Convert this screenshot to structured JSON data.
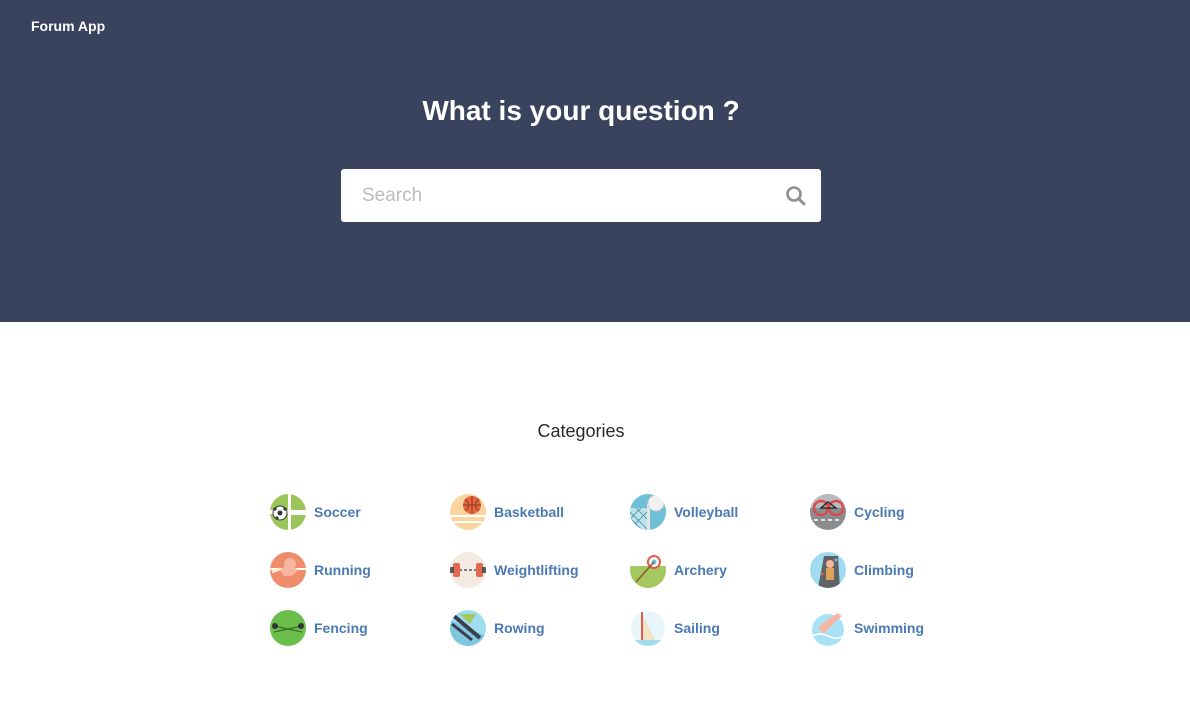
{
  "header": {
    "brand": "Forum App",
    "title": "What is your question ?",
    "background_color": "#3a435e"
  },
  "search": {
    "placeholder": "Search",
    "icon": "search-icon"
  },
  "categories": {
    "title": "Categories",
    "link_color": "#4a79b3",
    "items": [
      {
        "label": "Soccer",
        "icon": "soccer-icon"
      },
      {
        "label": "Basketball",
        "icon": "basketball-icon"
      },
      {
        "label": "Volleyball",
        "icon": "volleyball-icon"
      },
      {
        "label": "Cycling",
        "icon": "cycling-icon"
      },
      {
        "label": "Running",
        "icon": "running-icon"
      },
      {
        "label": "Weightlifting",
        "icon": "weightlifting-icon"
      },
      {
        "label": "Archery",
        "icon": "archery-icon"
      },
      {
        "label": "Climbing",
        "icon": "climbing-icon"
      },
      {
        "label": "Fencing",
        "icon": "fencing-icon"
      },
      {
        "label": "Rowing",
        "icon": "rowing-icon"
      },
      {
        "label": "Sailing",
        "icon": "sailing-icon"
      },
      {
        "label": "Swimming",
        "icon": "swimming-icon"
      }
    ]
  }
}
